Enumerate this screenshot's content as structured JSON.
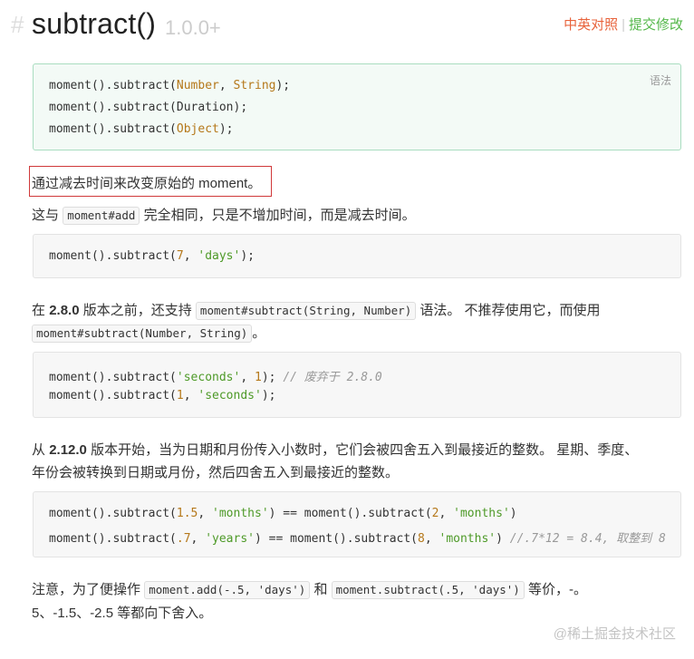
{
  "header": {
    "hash": "#",
    "title": "subtract()",
    "version": "1.0.0+",
    "link_compare": "中英对照",
    "link_separator": "|",
    "link_edit": "提交修改"
  },
  "syntax_block": {
    "badge": "语法",
    "lines": [
      {
        "prefix": "moment().subtract(",
        "arg1": "Number",
        "sep": ", ",
        "arg2": "String",
        "suffix": ");"
      },
      {
        "prefix": "moment().subtract(Duration);"
      },
      {
        "prefix": "moment().subtract(",
        "arg1": "Object",
        "suffix": ");"
      }
    ]
  },
  "intro": {
    "highlighted": "通过减去时间来改变原始的 moment。",
    "line2_pre": "这与",
    "line2_code": "moment#add",
    "line2_post": "完全相同，只是不增加时间，而是减去时间。"
  },
  "example1": {
    "prefix": "moment().subtract(",
    "num": "7",
    "sep": ", ",
    "str": "'days'",
    "suffix": ");"
  },
  "note_280": {
    "pre": "在",
    "version": "2.8.0",
    "mid": "版本之前，还支持",
    "code1": "moment#subtract(String, Number)",
    "post": "语法。 不推荐使用它，而使用",
    "code2": "moment#subtract(Number, String)",
    "end": "。"
  },
  "example2": {
    "line1_prefix": "moment().subtract(",
    "line1_str": "'seconds'",
    "line1_sep": ", ",
    "line1_num": "1",
    "line1_suffix": "); ",
    "line1_comment": "// 废弃于 2.8.0",
    "line2_prefix": "moment().subtract(",
    "line2_num": "1",
    "line2_sep": ", ",
    "line2_str": "'seconds'",
    "line2_suffix": ");"
  },
  "note_2120": {
    "pre": "从",
    "version": "2.12.0",
    "line1_post": "版本开始，当为日期和月份传入小数时，它们会被四舍五入到最接近的整数。 星期、季度、",
    "line2": "年份会被转换到日期或月份，然后四舍五入到最接近的整数。"
  },
  "example3": {
    "l1_a": "moment().subtract(",
    "l1_n1": "1.5",
    "l1_sep1": ", ",
    "l1_s1": "'months'",
    "l1_b": ") == moment().subtract(",
    "l1_n2": "2",
    "l1_sep2": ", ",
    "l1_s2": "'months'",
    "l1_c": ")",
    "l2_a": "moment().subtract(",
    "l2_n1": ".7",
    "l2_sep1": ", ",
    "l2_s1": "'years'",
    "l2_b": ") == moment().subtract(",
    "l2_n2": "8",
    "l2_sep2": ", ",
    "l2_s2": "'months'",
    "l2_c": ") ",
    "l2_comment": "//.7*12 = 8.4, 取整到 8"
  },
  "note_round": {
    "pre": "注意，为了便操作",
    "code1": "moment.add(-.5, 'days')",
    "mid": "和",
    "code2": "moment.subtract(.5, 'days')",
    "post": "等价，-。",
    "line2": "5、-1.5、-2.5 等都向下舍入。"
  },
  "watermark": "@稀土掘金技术社区",
  "colors": {
    "orange_link": "#e8633c",
    "green_link": "#54b84a",
    "number": "#b5781a",
    "string": "#4e9a28",
    "highlight_border": "#d0393a"
  }
}
